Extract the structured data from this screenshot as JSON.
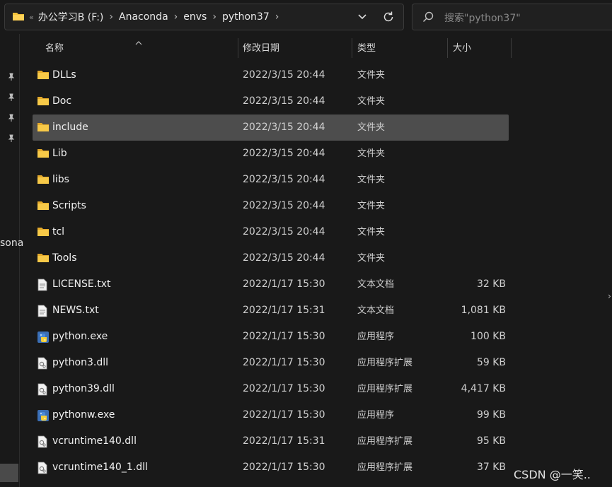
{
  "address_bar": {
    "lead": "«",
    "crumbs": [
      "办公学习B (F:)",
      "Anaconda",
      "envs",
      "python37"
    ]
  },
  "search": {
    "placeholder": "搜索\"python37\""
  },
  "nav": {
    "partial_label": "sona"
  },
  "columns": {
    "name": "名称",
    "date": "修改日期",
    "type": "类型",
    "size": "大小"
  },
  "files": [
    {
      "name": "DLLs",
      "date": "2022/3/15 20:44",
      "type": "文件夹",
      "size": "",
      "icon": "folder-icon"
    },
    {
      "name": "Doc",
      "date": "2022/3/15 20:44",
      "type": "文件夹",
      "size": "",
      "icon": "folder-icon"
    },
    {
      "name": "include",
      "date": "2022/3/15 20:44",
      "type": "文件夹",
      "size": "",
      "icon": "folder-icon",
      "selected": true
    },
    {
      "name": "Lib",
      "date": "2022/3/15 20:44",
      "type": "文件夹",
      "size": "",
      "icon": "folder-icon"
    },
    {
      "name": "libs",
      "date": "2022/3/15 20:44",
      "type": "文件夹",
      "size": "",
      "icon": "folder-icon"
    },
    {
      "name": "Scripts",
      "date": "2022/3/15 20:44",
      "type": "文件夹",
      "size": "",
      "icon": "folder-icon"
    },
    {
      "name": "tcl",
      "date": "2022/3/15 20:44",
      "type": "文件夹",
      "size": "",
      "icon": "folder-icon"
    },
    {
      "name": "Tools",
      "date": "2022/3/15 20:44",
      "type": "文件夹",
      "size": "",
      "icon": "folder-icon"
    },
    {
      "name": "LICENSE.txt",
      "date": "2022/1/17 15:30",
      "type": "文本文档",
      "size": "32 KB",
      "icon": "text-file-icon"
    },
    {
      "name": "NEWS.txt",
      "date": "2022/1/17 15:31",
      "type": "文本文档",
      "size": "1,081 KB",
      "icon": "text-file-icon"
    },
    {
      "name": "python.exe",
      "date": "2022/1/17 15:30",
      "type": "应用程序",
      "size": "100 KB",
      "icon": "python-exe-icon"
    },
    {
      "name": "python3.dll",
      "date": "2022/1/17 15:30",
      "type": "应用程序扩展",
      "size": "59 KB",
      "icon": "dll-file-icon"
    },
    {
      "name": "python39.dll",
      "date": "2022/1/17 15:30",
      "type": "应用程序扩展",
      "size": "4,417 KB",
      "icon": "dll-file-icon"
    },
    {
      "name": "pythonw.exe",
      "date": "2022/1/17 15:30",
      "type": "应用程序",
      "size": "99 KB",
      "icon": "python-exe-icon"
    },
    {
      "name": "vcruntime140.dll",
      "date": "2022/1/17 15:31",
      "type": "应用程序扩展",
      "size": "95 KB",
      "icon": "dll-file-icon"
    },
    {
      "name": "vcruntime140_1.dll",
      "date": "2022/1/17 15:30",
      "type": "应用程序扩展",
      "size": "37 KB",
      "icon": "dll-file-icon"
    }
  ],
  "watermark": "CSDN @一笑..",
  "colors": {
    "folder": "#f3c13a",
    "selected_row": "#4d4d4d",
    "background": "#191919"
  }
}
